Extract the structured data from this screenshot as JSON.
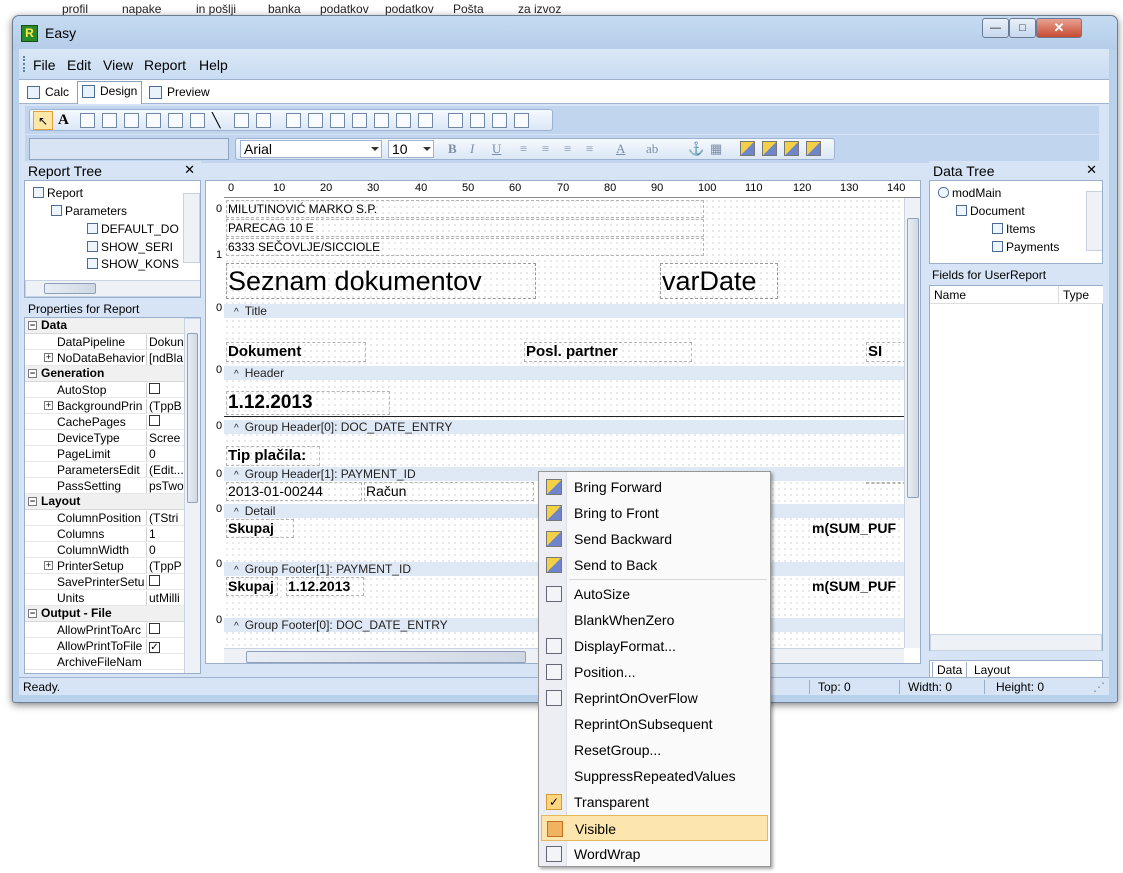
{
  "background_strip": [
    "profil",
    "napake",
    "in pošlji",
    "banka",
    "podatkov",
    "podatkov",
    "Pošta",
    "za izvoz"
  ],
  "window": {
    "title": "Easy",
    "app_icon_letter": "R",
    "controls": {
      "minimize": "—",
      "maximize": "□",
      "close": "✕"
    }
  },
  "menu": [
    "File",
    "Edit",
    "View",
    "Report",
    "Help"
  ],
  "tabs": [
    "Calc",
    "Design",
    "Preview"
  ],
  "active_tab": "Design",
  "font_toolbar": {
    "font_name": "Arial",
    "font_size": "10",
    "glyphs": [
      "B",
      "I",
      "U",
      "≡",
      "≡",
      "≡",
      "≡",
      "A",
      "ab",
      "⚓",
      "▦"
    ]
  },
  "report_tree": {
    "title": "Report Tree",
    "close": "✕",
    "items": [
      {
        "label": "Report",
        "depth": 0
      },
      {
        "label": "Parameters",
        "depth": 1
      },
      {
        "label": "DEFAULT_DO",
        "depth": 2
      },
      {
        "label": "SHOW_SERI",
        "depth": 2
      },
      {
        "label": "SHOW_KONS",
        "depth": 2
      }
    ]
  },
  "properties": {
    "title": "Properties for Report",
    "rows": [
      {
        "type": "category",
        "name": "Data"
      },
      {
        "type": "prop",
        "name": "DataPipeline",
        "value": "Dokun"
      },
      {
        "type": "prop",
        "name": "NoDataBehavior",
        "value": "[ndBla",
        "expand": true
      },
      {
        "type": "category",
        "name": "Generation"
      },
      {
        "type": "prop",
        "name": "AutoStop",
        "value": "",
        "checkbox": "unchecked"
      },
      {
        "type": "prop",
        "name": "BackgroundPrin",
        "value": "(TppB",
        "expand": true
      },
      {
        "type": "prop",
        "name": "CachePages",
        "value": "",
        "checkbox": "unchecked"
      },
      {
        "type": "prop",
        "name": "DeviceType",
        "value": "Scree"
      },
      {
        "type": "prop",
        "name": "PageLimit",
        "value": "0"
      },
      {
        "type": "prop",
        "name": "ParametersEdit",
        "value": "(Edit..."
      },
      {
        "type": "prop",
        "name": "PassSetting",
        "value": "psTwo"
      },
      {
        "type": "category",
        "name": "Layout"
      },
      {
        "type": "prop",
        "name": "ColumnPosition",
        "value": "(TStri"
      },
      {
        "type": "prop",
        "name": "Columns",
        "value": "1"
      },
      {
        "type": "prop",
        "name": "ColumnWidth",
        "value": "0"
      },
      {
        "type": "prop",
        "name": "PrinterSetup",
        "value": "(TppP",
        "expand": true
      },
      {
        "type": "prop",
        "name": "SavePrinterSetu",
        "value": "",
        "checkbox": "unchecked"
      },
      {
        "type": "prop",
        "name": "Units",
        "value": "utMilli"
      },
      {
        "type": "category",
        "name": "Output - File"
      },
      {
        "type": "prop",
        "name": "AllowPrintToArc",
        "value": "",
        "checkbox": "unchecked"
      },
      {
        "type": "prop",
        "name": "AllowPrintToFile",
        "value": "",
        "checkbox": "checked"
      },
      {
        "type": "prop",
        "name": "ArchiveFileNam",
        "value": ""
      }
    ]
  },
  "ruler": {
    "top_labels": [
      "0",
      "10",
      "20",
      "30",
      "40",
      "50",
      "60",
      "70",
      "80",
      "90",
      "100",
      "110",
      "120",
      "130",
      "140"
    ],
    "left_labels": [
      "0",
      "1",
      "0",
      "0",
      "0",
      "0",
      "0",
      "0",
      "0",
      "0"
    ]
  },
  "design": {
    "company_lines": [
      "MILUTINOVIĆ MARKO S.P.",
      "PARECAG 10 E",
      "6333   SEČOVLJE/SICCIOLE"
    ],
    "title_text": "Seznam dokumentov",
    "title_var": "varDate",
    "header_labels": [
      "Dokument",
      "Posl. partner",
      "SI"
    ],
    "group0_date": "1.12.2013",
    "group1_label": "Tip plačila:",
    "detail_doc": "2013-01-00244",
    "detail_type": "Račun",
    "sum_label": "Skupaj",
    "sum_label2": "Skupaj",
    "sum_date": "1.12.2013",
    "sum_field": "m(SUM_PUF",
    "sum_field2": "m(SUM_PUF",
    "bands": [
      "Title",
      "Header",
      "Group Header[0]: DOC_DATE_ENTRY",
      "Group Header[1]: PAYMENT_ID",
      "Detail",
      "Group Footer[1]: PAYMENT_ID",
      "Group Footer[0]: DOC_DATE_ENTRY"
    ]
  },
  "data_tree": {
    "title": "Data Tree",
    "close": "✕",
    "items": [
      "modMain",
      "Document",
      "Items",
      "Payments"
    ],
    "fields_title": "Fields for UserReport",
    "columns": [
      "Name",
      "Type"
    ],
    "tabs": [
      "Data",
      "Layout"
    ]
  },
  "status": {
    "ready": "Ready.",
    "top": "Top: 0",
    "width": "Width: 0",
    "height": "Height: 0"
  },
  "context_menu": {
    "items": [
      {
        "label": "Bring Forward",
        "icon": "bring-forward-icon"
      },
      {
        "label": "Bring to Front",
        "icon": "bring-to-front-icon"
      },
      {
        "label": "Send Backward",
        "icon": "send-backward-icon"
      },
      {
        "label": "Send to Back",
        "icon": "send-to-back-icon"
      },
      {
        "label": "AutoSize",
        "icon": "autosize-icon"
      },
      {
        "label": "BlankWhenZero",
        "icon": ""
      },
      {
        "label": "DisplayFormat...",
        "icon": "display-format-icon"
      },
      {
        "label": "Position...",
        "icon": "position-icon"
      },
      {
        "label": "ReprintOnOverFlow",
        "icon": "reprint-icon"
      },
      {
        "label": "ReprintOnSubsequent",
        "icon": ""
      },
      {
        "label": "ResetGroup...",
        "icon": ""
      },
      {
        "label": "SuppressRepeatedValues",
        "icon": ""
      },
      {
        "label": "Transparent",
        "icon": "check-icon"
      },
      {
        "label": "Visible",
        "icon": "visible-icon",
        "highlighted": true
      },
      {
        "label": "WordWrap",
        "icon": "wordwrap-icon"
      }
    ]
  }
}
